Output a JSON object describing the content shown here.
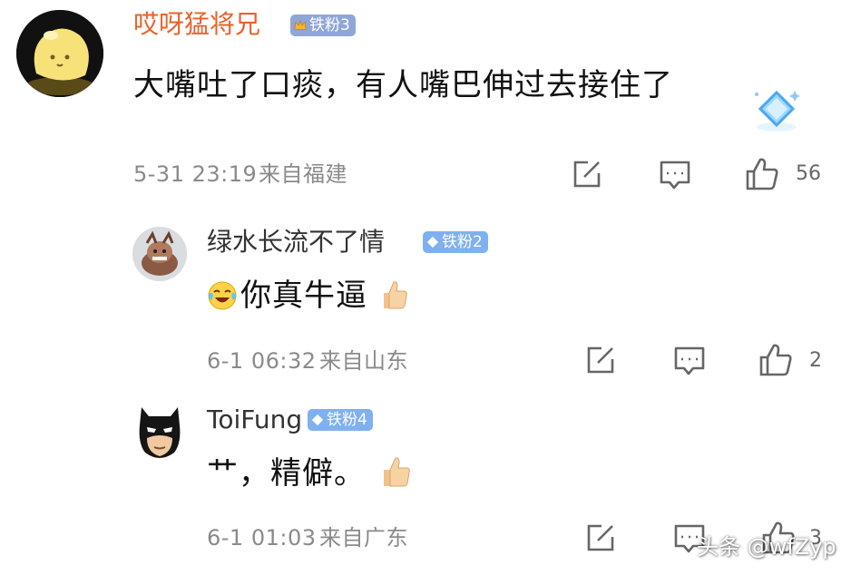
{
  "colors": {
    "username_vip": "#e8622a",
    "username_normal": "#333333",
    "badge_gold": "#8fa6d8",
    "badge_blue": "#7fb0f0",
    "meta_text": "#8a8a8a"
  },
  "comments": [
    {
      "user": "哎呀猛将兄",
      "badge": "铁粉3",
      "badge_icon": "crown-icon",
      "text": "大嘴吐了口痰，有人嘴巴伸过去接住了",
      "time": "5-31 23:19",
      "location": "来自福建",
      "likes": "56"
    },
    {
      "user": "绿水长流不了情",
      "badge": "铁粉2",
      "badge_icon": "diamond-icon",
      "emoji_lead": "laughing-crying-emoji",
      "text": "你真牛逼",
      "emoji_trail": "thumbs-up-emoji",
      "time": "6-1 06:32",
      "location": "来自山东",
      "likes": "2"
    },
    {
      "user": "ToiFung",
      "badge": "铁粉4",
      "badge_icon": "diamond-icon",
      "text": "艹，精僻。",
      "emoji_trail": "thumbs-up-emoji",
      "time": "6-1 01:03",
      "location": "来自广东",
      "likes": "3"
    }
  ],
  "watermark": "头条 @wfZyp"
}
